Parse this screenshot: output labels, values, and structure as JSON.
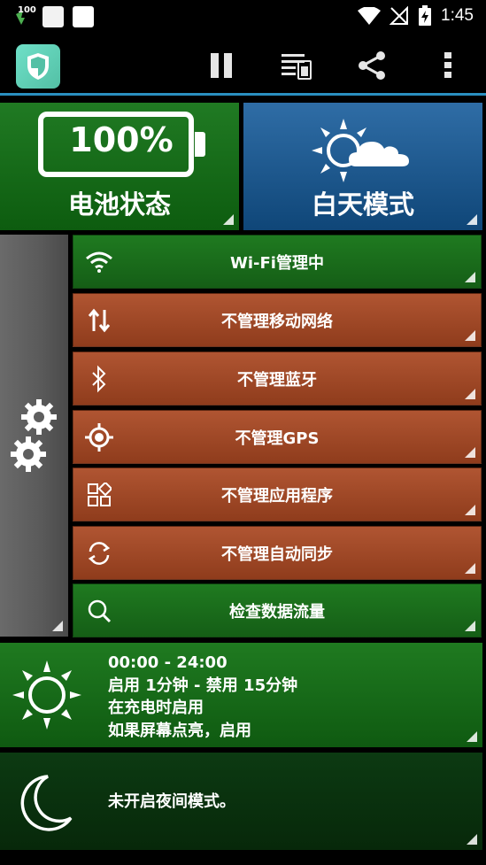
{
  "status_bar": {
    "battery_badge": "100",
    "time": "1:45"
  },
  "toolbar": {
    "pause_icon": "pause-icon",
    "profiles_icon": "profiles-icon",
    "share_icon": "share-icon",
    "more_icon": "more-vert-icon"
  },
  "tiles": {
    "battery_percent": "100%",
    "battery_label": "电池状态",
    "day_label": "白天模式"
  },
  "rows": [
    {
      "label": "Wi-Fi管理中",
      "icon": "wifi-icon",
      "color": "#1f7a20"
    },
    {
      "label": "不管理移动网络",
      "icon": "mobile-data-icon",
      "color": "#a4482a"
    },
    {
      "label": "不管理蓝牙",
      "icon": "bluetooth-icon",
      "color": "#a4482a"
    },
    {
      "label": "不管理GPS",
      "icon": "gps-icon",
      "color": "#a4482a"
    },
    {
      "label": "不管理应用程序",
      "icon": "apps-icon",
      "color": "#a4482a"
    },
    {
      "label": "不管理自动同步",
      "icon": "sync-icon",
      "color": "#a4482a"
    },
    {
      "label": "检查数据流量",
      "icon": "search-icon",
      "color": "#1f7a20"
    }
  ],
  "schedule": {
    "time_range": "00:00 - 24:00",
    "interval": "启用 1分钟 - 禁用 15分钟",
    "charging": "在充电时启用",
    "screen_on": "如果屏幕点亮，启用"
  },
  "night": {
    "text": "未开启夜间模式。"
  }
}
